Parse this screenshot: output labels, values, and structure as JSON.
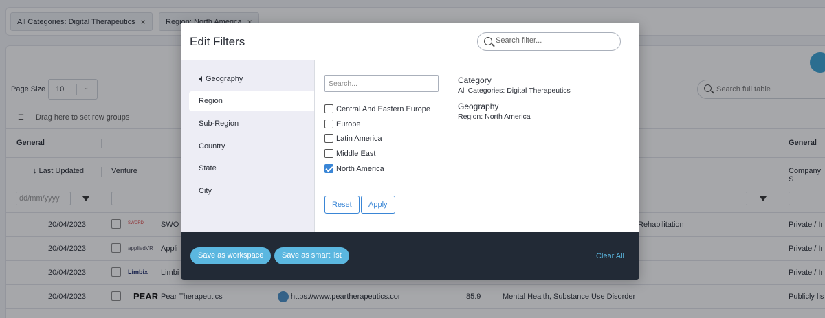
{
  "active_filters": [
    {
      "label": "All Categories: Digital Therapeutics",
      "remove": "×"
    },
    {
      "label": "Region: North America",
      "remove": "×"
    }
  ],
  "table": {
    "page_size_label": "Page Size",
    "page_size_value": "10",
    "search_placeholder": "Search full table",
    "row_group_hint": "Drag here to set row groups",
    "group_headers": {
      "left": "General",
      "right": "General"
    },
    "columns": {
      "last_updated": "↓  Last Updated",
      "venture": "Venture",
      "company": "Company S"
    },
    "date_filter_placeholder": "dd/mm/yyyy",
    "rows": [
      {
        "date": "20/04/2023",
        "name": "SWO",
        "logo": "SWORD",
        "extra": "Rehabilitation",
        "right": "Private / Ir"
      },
      {
        "date": "20/04/2023",
        "name": "Appli",
        "logo": "appliedVR",
        "extra": "",
        "right": "Private / Ir"
      },
      {
        "date": "20/04/2023",
        "name": "Limbi",
        "logo": "Limbix",
        "extra": "",
        "right": "Private / Ir"
      },
      {
        "date": "20/04/2023",
        "name": "Pear Therapeutics",
        "logo": "PEAR",
        "url": "https://www.peartherapeutics.cor",
        "score": "85.9",
        "extra": "Mental Health, Substance Use Disorder",
        "right": "Publicly lis"
      }
    ]
  },
  "modal": {
    "title": "Edit Filters",
    "search_placeholder": "Search filter...",
    "nav": {
      "header": "Geography",
      "items": [
        "Region",
        "Sub-Region",
        "Country",
        "State",
        "City"
      ],
      "active": "Region"
    },
    "options_search_placeholder": "Search...",
    "options": [
      {
        "label": "Central And Eastern Europe",
        "checked": false
      },
      {
        "label": "Europe",
        "checked": false
      },
      {
        "label": "Latin America",
        "checked": false
      },
      {
        "label": "Middle East",
        "checked": false
      },
      {
        "label": "North America",
        "checked": true
      }
    ],
    "reset_label": "Reset",
    "apply_label": "Apply",
    "summary": [
      {
        "heading": "Category",
        "value": "All Categories: Digital Therapeutics"
      },
      {
        "heading": "Geography",
        "value": "Region: North America"
      }
    ],
    "footer": {
      "save_workspace": "Save as workspace",
      "save_smart_list": "Save as smart list",
      "clear_all": "Clear All"
    }
  },
  "colors": {
    "accent": "#3a86d6",
    "pill": "#5bb7e0",
    "footer_bg": "#222a36",
    "nav_bg": "#ededf5"
  }
}
